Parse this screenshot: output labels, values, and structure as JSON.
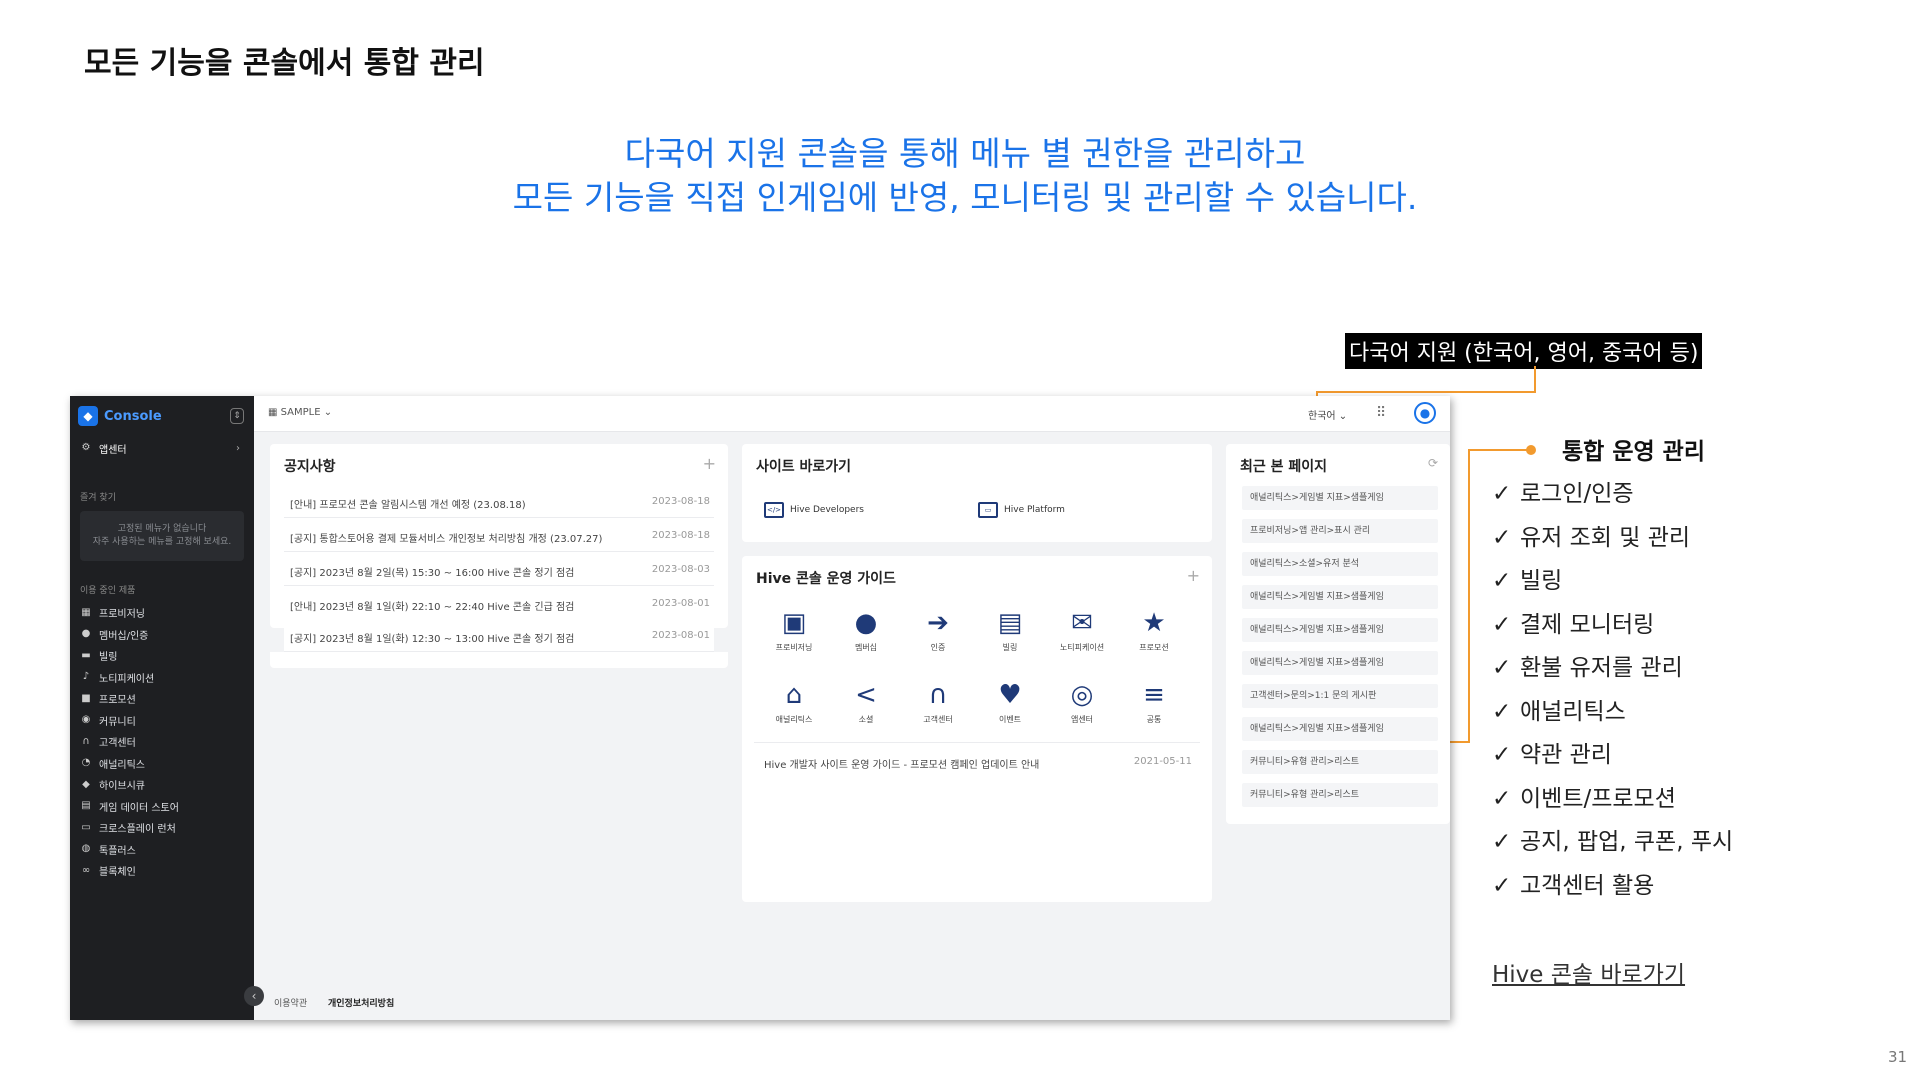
{
  "slide": {
    "title": "모든 기능을 콘솔에서 통합 관리",
    "headline_1": "다국어 지원 콘솔을 통해 메뉴 별 권한을 관리하고",
    "headline_2": "모든 기능을  직접 인게임에 반영, 모니터링 및 관리할 수 있습니다.",
    "lang_callout": "다국어 지원 (한국어, 영어, 중국어 등)",
    "side_title": "통합 운영 관리",
    "check_glyph": "✓",
    "features": [
      "로그인/인증",
      "유저 조회 및 관리",
      "빌링",
      "결제 모니터링",
      "환불 유저를 관리",
      "애널리틱스",
      "약관 관리",
      "이벤트/프로모션",
      "공지, 팝업, 쿠폰, 푸시",
      "고객센터 활용"
    ],
    "console_link": "Hive 콘솔 바로가기",
    "page_number": "31",
    "accent_color": "#1a73e8",
    "callout_color": "#f29a2e"
  },
  "console": {
    "brand": "Console",
    "app_menu": "앱센터",
    "sec_favorites": "즐겨 찾기",
    "favorites_empty_1": "고정된 메뉴가 없습니다",
    "favorites_empty_2": "자주 사용하는 메뉴를 고정해 보세요.",
    "sec_menu": "이용 중인 제품",
    "menu_items": [
      {
        "icon": "▦",
        "label": "프로비저닝"
      },
      {
        "icon": "●",
        "label": "멤버십/인증"
      },
      {
        "icon": "▬",
        "label": "빌링"
      },
      {
        "icon": "♪",
        "label": "노티피케이션"
      },
      {
        "icon": "■",
        "label": "프로모션"
      },
      {
        "icon": "◉",
        "label": "커뮤니티"
      },
      {
        "icon": "∩",
        "label": "고객센터"
      },
      {
        "icon": "◔",
        "label": "애널리틱스"
      },
      {
        "icon": "◆",
        "label": "하이브시큐"
      },
      {
        "icon": "▤",
        "label": "게임 데이터 스토어"
      },
      {
        "icon": "▭",
        "label": "크로스플레이 런처"
      },
      {
        "icon": "◍",
        "label": "톡플러스"
      },
      {
        "icon": "∞",
        "label": "블록체인"
      }
    ],
    "project": "SAMPLE",
    "language": "한국어",
    "notice": {
      "title": "공지사항",
      "rows": [
        {
          "text": "[안내] 프로모션 콘솔 알림시스템 개선 예정 (23.08.18)",
          "date": "2023-08-18"
        },
        {
          "text": "[공지] 통합스토어용 결제 모듈서비스 개인정보 처리방침 개정 (23.07.27)",
          "date": "2023-08-18"
        },
        {
          "text": "[공지] 2023년 8월 2일(목) 15:30 ~ 16:00 Hive 콘솔 정기 점검",
          "date": "2023-08-03"
        },
        {
          "text": "[안내] 2023년 8월 1일(화) 22:10 ~ 22:40 Hive 콘솔 긴급 점검",
          "date": "2023-08-01"
        },
        {
          "text": "[공지] 2023년 8월 1일(화) 12:30 ~ 13:00 Hive 콘솔 정기 점검",
          "date": "2023-08-01"
        }
      ]
    },
    "shortcuts": {
      "title": "사이트 바로가기",
      "links": [
        "Hive Developers",
        "Hive Platform"
      ]
    },
    "guide": {
      "title": "Hive 콘솔 운영 가이드",
      "items": [
        {
          "icon": "▣",
          "label": "프로비저닝"
        },
        {
          "icon": "●",
          "label": "멤버십"
        },
        {
          "icon": "➔",
          "label": "인증"
        },
        {
          "icon": "▤",
          "label": "빌링"
        },
        {
          "icon": "✉",
          "label": "노티피케이션"
        },
        {
          "icon": "★",
          "label": "프로모션"
        },
        {
          "icon": "⌂",
          "label": "애널리틱스"
        },
        {
          "icon": "<",
          "label": "소셜"
        },
        {
          "icon": "∩",
          "label": "고객센터"
        },
        {
          "icon": "♥",
          "label": "이벤트"
        },
        {
          "icon": "◎",
          "label": "앱센터"
        },
        {
          "icon": "≡",
          "label": "공통"
        }
      ],
      "note": "Hive 개발자 사이트 운영 가이드 - 프로모션 캠페인 업데이트 안내",
      "note_date": "2021-05-11"
    },
    "recent": {
      "title": "최근 본 페이지",
      "items": [
        "애널리틱스>게임별 지표>샘플게임",
        "프로비저닝>앱 관리>표시 관리",
        "애널리틱스>소셜>유저 분석",
        "애널리틱스>게임별 지표>샘플게임",
        "애널리틱스>게임별 지표>샘플게임",
        "애널리틱스>게임별 지표>샘플게임",
        "고객센터>문의>1:1 문의 게시판",
        "애널리틱스>게임별 지표>샘플게임",
        "커뮤니티>유형 관리>리스트",
        "커뮤니티>유형 관리>리스트"
      ]
    },
    "footer": [
      "이용약관",
      "개인정보처리방침"
    ]
  }
}
